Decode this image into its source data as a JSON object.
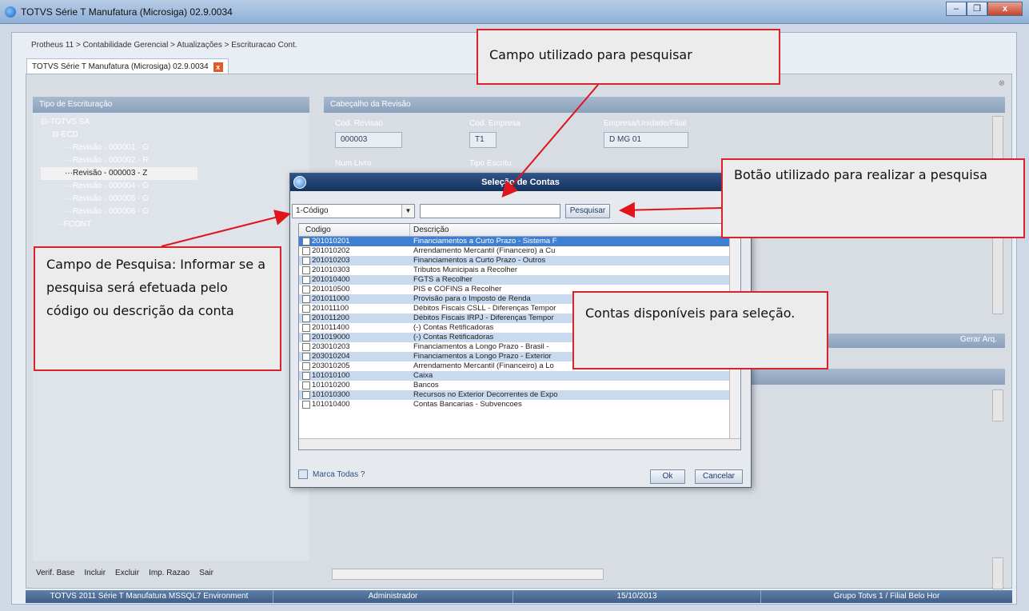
{
  "window": {
    "title": "TOTVS Série T Manufatura (Microsiga) 02.9.0034",
    "min": "–",
    "max": "❐",
    "close": "x"
  },
  "breadcrumb": "Protheus 11 > Contabilidade Gerencial > Atualizações > Escrituracao Cont.",
  "tab": {
    "label": "TOTVS Série T Manufatura (Microsiga) 02.9.0034",
    "close": "x"
  },
  "left_panel": {
    "header": "Tipo de Escrituração",
    "tree": [
      {
        "label": "TOTVS SA",
        "prefix": "⊟-"
      },
      {
        "label": "ECD",
        "prefix": "⊟-"
      },
      {
        "label": "Revisão - 000001 - G",
        "prefix": "···"
      },
      {
        "label": "Revisão - 000002 - R",
        "prefix": "···"
      },
      {
        "label": "Revisão - 000003 - Z",
        "prefix": "···"
      },
      {
        "label": "Revisão - 000004 - G",
        "prefix": "···"
      },
      {
        "label": "Revisão - 000005 - G",
        "prefix": "···"
      },
      {
        "label": "Revisão - 000006 - G",
        "prefix": "···"
      },
      {
        "label": "FCONT",
        "prefix": "··"
      }
    ],
    "buttons": [
      "Verif. Base",
      "Incluir",
      "Excluir",
      "Imp. Razao",
      "Sair"
    ]
  },
  "right_panel": {
    "header": "Cabeçalho da Revisão",
    "fields": {
      "cod_revisao_label": "Cod. Revisao",
      "cod_revisao": "000003",
      "cod_empresa_label": "Cod. Empresa",
      "cod_empresa": "T1",
      "empresa_label": "Empresa/Unidade/Filial",
      "empresa": "D MG 01",
      "num_livro_label": "Num Livro",
      "tipo_escritu_label": "Tipo Escritu"
    },
    "gerar": "Gerar Arq."
  },
  "dialog": {
    "title": "Seleção de Contas",
    "combo_value": "1-Código",
    "search_value": "",
    "search_button": "Pesquisar",
    "columns": [
      "Codigo",
      "Descrição"
    ],
    "rows": [
      [
        "201010201",
        "Financiamentos a Curto Prazo - Sistema F"
      ],
      [
        "201010202",
        "Arrendamento Mercantil (Financeiro) a Cu"
      ],
      [
        "201010203",
        "Financiamentos a Curto Prazo - Outros"
      ],
      [
        "201010303",
        "Tributos Municipais a Recolher"
      ],
      [
        "201010400",
        "FGTS a Recolher"
      ],
      [
        "201010500",
        "PIS e COFINS a Recolher"
      ],
      [
        "201011000",
        "Provisão para o Imposto de Renda"
      ],
      [
        "201011100",
        "Débitos Fiscais CSLL - Diferenças Tempor"
      ],
      [
        "201011200",
        "Débitos Fiscais IRPJ - Diferenças Tempor"
      ],
      [
        "201011400",
        "(-) Contas Retificadoras"
      ],
      [
        "201019000",
        "(-) Contas Retificadoras"
      ],
      [
        "203010203",
        "Financiamentos a Longo Prazo - Brasil -"
      ],
      [
        "203010204",
        "Financiamentos a Longo Prazo - Exterior"
      ],
      [
        "203010205",
        "Arrendamento Mercantil (Financeiro) a Lo"
      ],
      [
        "101010100",
        "Caixa"
      ],
      [
        "101010200",
        "Bancos"
      ],
      [
        "101010300",
        "Recursos no Exterior Decorrentes de Expo"
      ],
      [
        "101010400",
        "Contas Bancarias - Subvencoes"
      ]
    ],
    "marca_todas": "Marca Todas ?",
    "ok": "Ok",
    "cancel": "Cancelar"
  },
  "statusbar": [
    "TOTVS 2011 Série T Manufatura MSSQL7 Environment",
    "Administrador",
    "15/10/2013",
    "Grupo Totvs 1 / Filial Belo Hor"
  ],
  "callouts": {
    "search_field": "Campo utilizado para pesquisar",
    "search_button": "Botão utilizado para realizar a pesquisa",
    "campo_pesquisa": "Campo de Pesquisa: Informar se a pesquisa será efetuada pelo código ou descrição da conta",
    "contas": "Contas disponíveis para seleção."
  },
  "colors": {
    "accent": "#d8232a",
    "selected_row": "#3f7fd3",
    "alt_row": "#c9d9ee",
    "dialog_title": "#14325c"
  }
}
